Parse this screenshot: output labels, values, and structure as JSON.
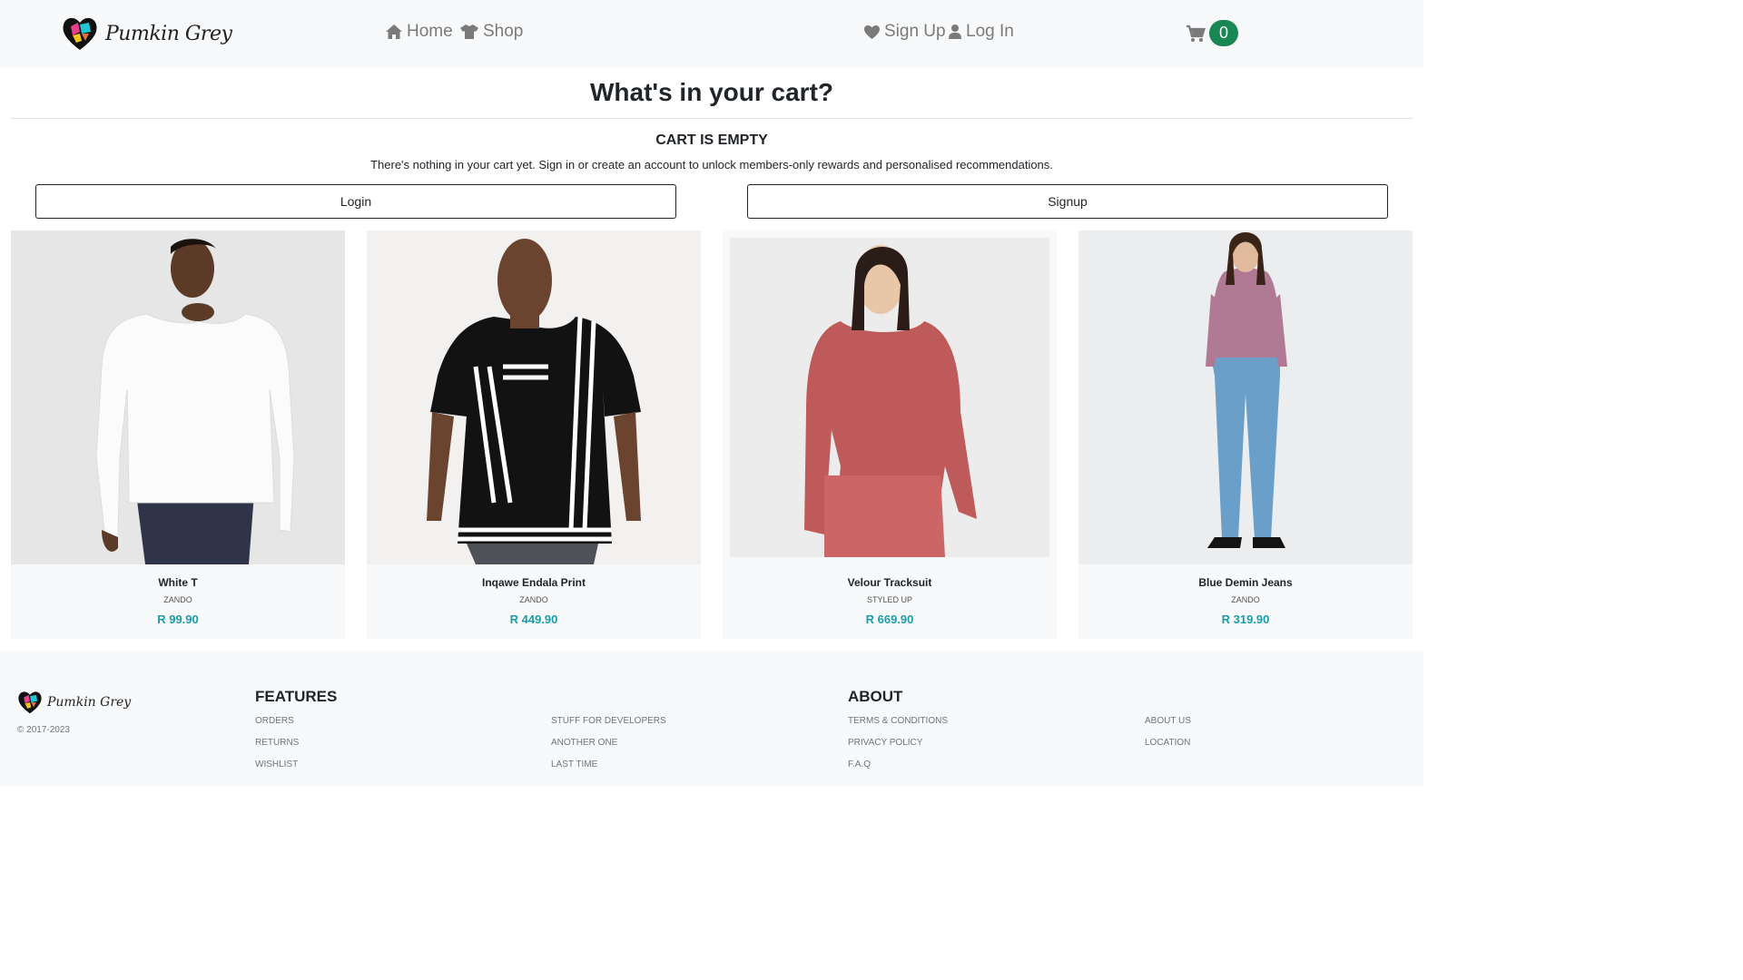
{
  "nav": {
    "logo_text": "Pumkin Grey",
    "home_label": "Home",
    "shop_label": "Shop",
    "signup_label": "Sign Up",
    "login_label": "Log In",
    "cart_count": "0"
  },
  "cart": {
    "title": "What's in your cart?",
    "empty_heading": "CART IS EMPTY",
    "empty_message": "There's nothing in your cart yet. Sign in or create an account to unlock members-only rewards and personalised recommendations.",
    "login_button": "Login",
    "signup_button": "Signup"
  },
  "products": [
    {
      "name": "White T",
      "brand": "ZANDO",
      "price": "R 99.90"
    },
    {
      "name": "Inqawe Endala Print",
      "brand": "ZANDO",
      "price": "R 449.90"
    },
    {
      "name": "Velour Tracksuit",
      "brand": "STYLED UP",
      "price": "R 669.90"
    },
    {
      "name": "Blue Demin Jeans",
      "brand": "ZANDO",
      "price": "R 319.90"
    }
  ],
  "footer": {
    "logo_text": "Pumkin Grey",
    "copyright": "© 2017-2023",
    "features_heading": "FEATURES",
    "features_links": [
      "ORDERS",
      "RETURNS",
      "WISHLIST"
    ],
    "extra_links": [
      "STUFF FOR DEVELOPERS",
      "ANOTHER ONE",
      "LAST TIME"
    ],
    "about_heading": "ABOUT",
    "about_links": [
      "TERMS & CONDITIONS",
      "PRIVACY POLICY",
      "F.A.Q"
    ],
    "about_extra_links": [
      "ABOUT US",
      "LOCATION"
    ]
  },
  "colors": {
    "badge": "#198754",
    "price": "#1b9ca8",
    "nav_bg": "#f8f9fa"
  }
}
